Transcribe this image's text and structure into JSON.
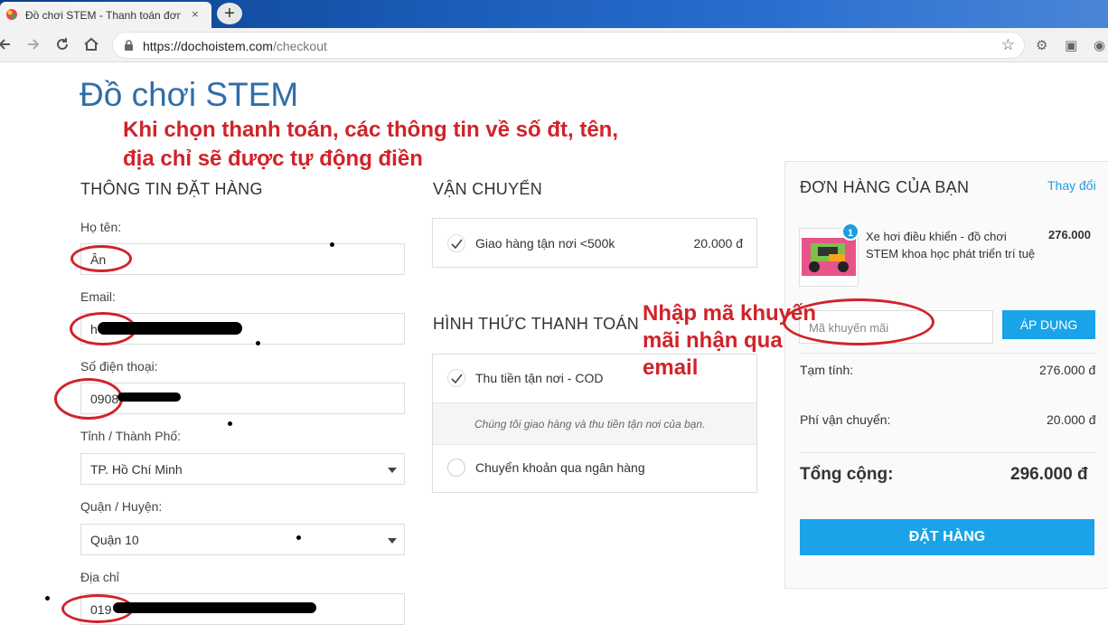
{
  "browser": {
    "tab_title": "Đồ chơi STEM - Thanh toán đơn",
    "tab_close": "×",
    "new_tab": "+",
    "url_host": "https://dochoistem.com",
    "url_path": "/checkout"
  },
  "brand": "Đồ chơi STEM",
  "order_info": {
    "title": "THÔNG TIN ĐẶT HÀNG",
    "name_label": "Họ tên:",
    "name_value": "Ân",
    "email_label": "Email:",
    "email_value": "h",
    "phone_label": "Số điện thoại:",
    "phone_value": "0908",
    "city_label": "Tỉnh / Thành Phố:",
    "city_value": "TP. Hồ Chí Minh",
    "district_label": "Quận / Huyện:",
    "district_value": "Quận 10",
    "address_label": "Địa chỉ",
    "address_value": "019"
  },
  "shipping": {
    "title": "VẬN CHUYỂN",
    "option_label": "Giao hàng tận nơi <500k",
    "option_price": "20.000 đ"
  },
  "payment": {
    "title": "HÌNH THỨC THANH TOÁN",
    "cod_label": "Thu tiền tận nơi - COD",
    "cod_note": "Chúng tôi giao hàng và thu tiền tận nơi của bạn.",
    "bank_label": "Chuyển khoản qua ngân hàng"
  },
  "cart": {
    "title": "ĐƠN HÀNG CỦA BẠN",
    "change_link": "Thay đổi",
    "item_qty": "1",
    "item_name": "Xe hơi điều khiển - đồ chơi STEM khoa học phát triển trí tuệ",
    "item_price": "276.000",
    "coupon_placeholder": "Mã khuyến mãi",
    "apply_button": "ÁP DỤNG",
    "subtotal_label": "Tạm tính:",
    "subtotal_value": "276.000 đ",
    "shipping_label": "Phí vận chuyển:",
    "shipping_value": "20.000 đ",
    "total_label": "Tổng cộng:",
    "total_value": "296.000 đ",
    "order_button": "ĐẶT HÀNG"
  },
  "annotations": {
    "autofill_note": "Khi chọn thanh toán, các thông tin về số đt, tên, địa chỉ sẽ được tự động điền",
    "coupon_note": "Nhập mã khuyến mãi nhận qua email"
  },
  "colors": {
    "brand": "#2f6ea8",
    "accent": "#1aa3e8",
    "annotation": "#d0232a"
  }
}
